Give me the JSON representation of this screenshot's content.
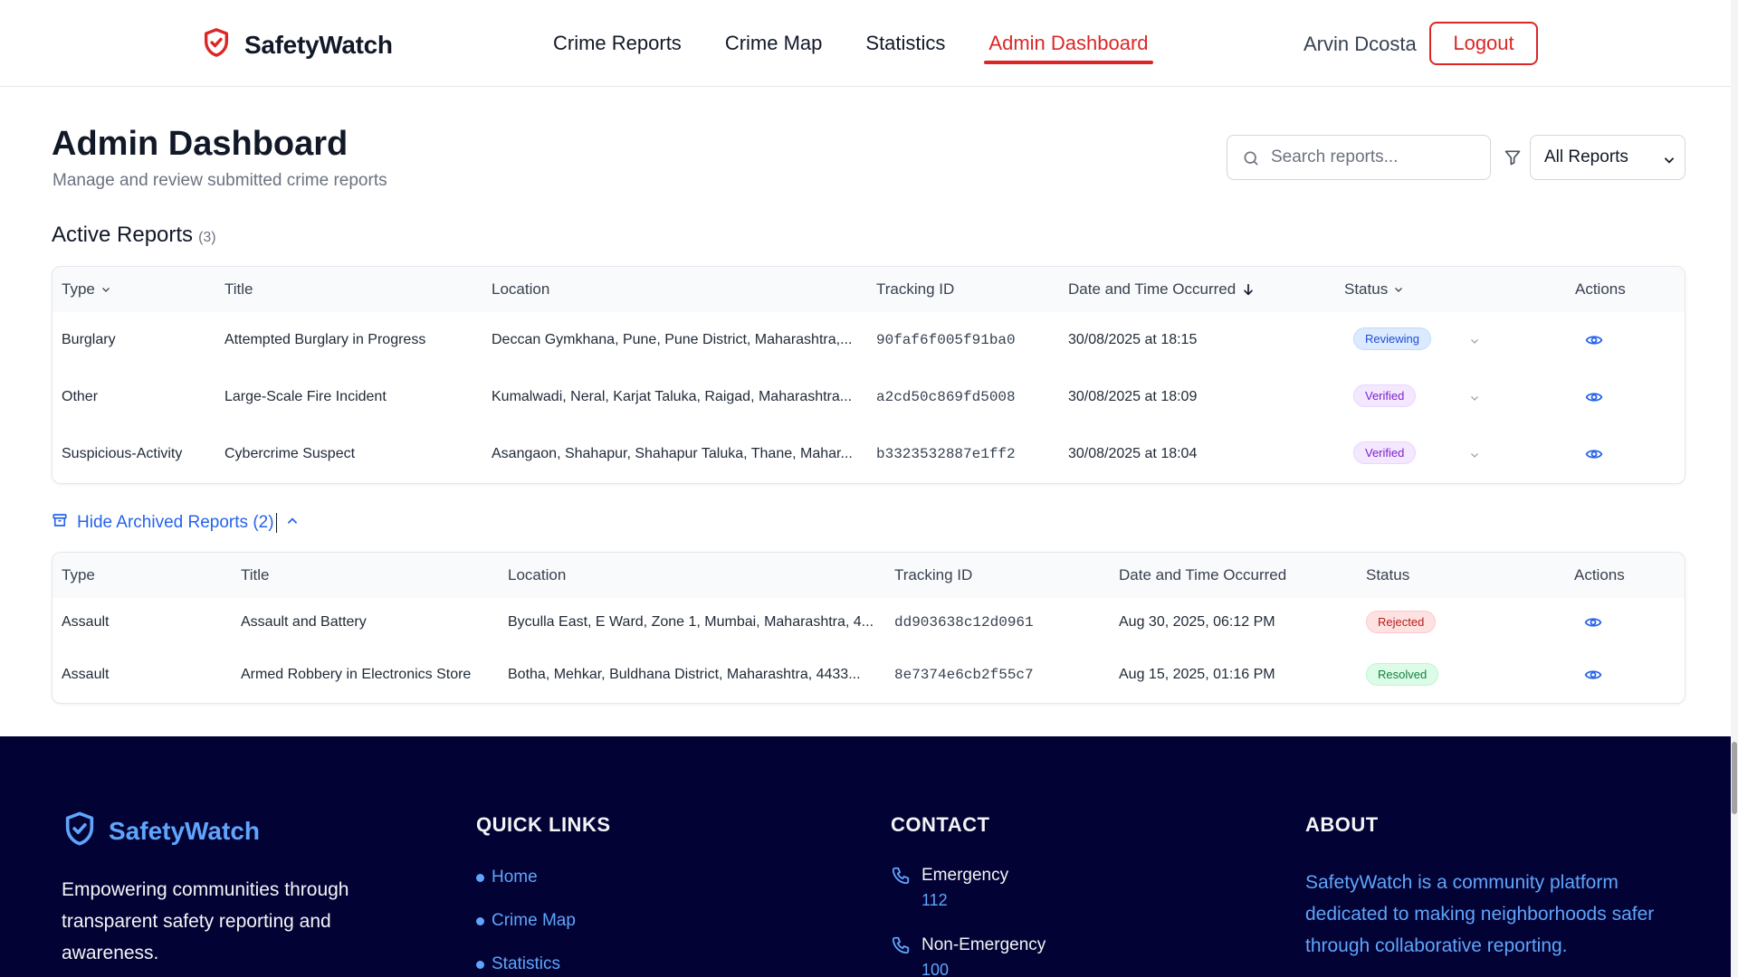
{
  "header": {
    "brand": "SafetyWatch",
    "nav": [
      "Crime Reports",
      "Crime Map",
      "Statistics",
      "Admin Dashboard"
    ],
    "active_nav": "Admin Dashboard",
    "user_name": "Arvin Dcosta",
    "logout_label": "Logout"
  },
  "page": {
    "title": "Admin Dashboard",
    "subtitle": "Manage and review submitted crime reports",
    "search_placeholder": "Search reports...",
    "filter_value": "All Reports"
  },
  "active_reports": {
    "title": "Active Reports",
    "count": "(3)",
    "columns": [
      "Type",
      "Title",
      "Location",
      "Tracking ID",
      "Date and Time Occurred",
      "Status",
      "Actions"
    ],
    "rows": [
      {
        "type": "Burglary",
        "title": "Attempted Burglary in Progress",
        "location": "Deccan Gymkhana, Pune, Pune District, Maharashtra,...",
        "tracking_id": "90faf6f005f91ba0",
        "datetime": "30/08/2025 at 18:15",
        "status": "Reviewing"
      },
      {
        "type": "Other",
        "title": "Large-Scale Fire Incident",
        "location": "Kumalwadi, Neral, Karjat Taluka, Raigad, Maharashtra...",
        "tracking_id": "a2cd50c869fd5008",
        "datetime": "30/08/2025 at 18:09",
        "status": "Verified"
      },
      {
        "type": "Suspicious-Activity",
        "title": "Cybercrime Suspect",
        "location": "Asangaon, Shahapur, Shahapur Taluka, Thane, Mahar...",
        "tracking_id": "b3323532887e1ff2",
        "datetime": "30/08/2025 at 18:04",
        "status": "Verified"
      }
    ]
  },
  "archived_reports": {
    "toggle_label": "Hide Archived Reports (2)",
    "columns": [
      "Type",
      "Title",
      "Location",
      "Tracking ID",
      "Date and Time Occurred",
      "Status",
      "Actions"
    ],
    "rows": [
      {
        "type": "Assault",
        "title": "Assault and Battery",
        "location": "Byculla East, E Ward, Zone 1, Mumbai, Maharashtra, 4...",
        "tracking_id": "dd903638c12d0961",
        "datetime": "Aug 30, 2025, 06:12 PM",
        "status": "Rejected"
      },
      {
        "type": "Assault",
        "title": "Armed Robbery in Electronics Store",
        "location": "Botha, Mehkar, Buldhana District, Maharashtra, 4433...",
        "tracking_id": "8e7374e6cb2f55c7",
        "datetime": "Aug 15, 2025, 01:16 PM",
        "status": "Resolved"
      }
    ]
  },
  "footer": {
    "brand": "SafetyWatch",
    "tagline": "Empowering communities through transparent safety reporting and awareness.",
    "quick_links_heading": "QUICK LINKS",
    "quick_links": [
      "Home",
      "Crime Map",
      "Statistics"
    ],
    "contact_heading": "CONTACT",
    "contacts": [
      {
        "label": "Emergency",
        "value": "112"
      },
      {
        "label": "Non-Emergency",
        "value": "100"
      }
    ],
    "about_heading": "ABOUT",
    "about_text": "SafetyWatch is a community platform dedicated to making neighborhoods safer through collaborative reporting."
  },
  "colors": {
    "accent_red": "#dc2626",
    "link_blue": "#2563eb",
    "footer_bg": "#020235",
    "footer_accent": "#60a5fa"
  }
}
